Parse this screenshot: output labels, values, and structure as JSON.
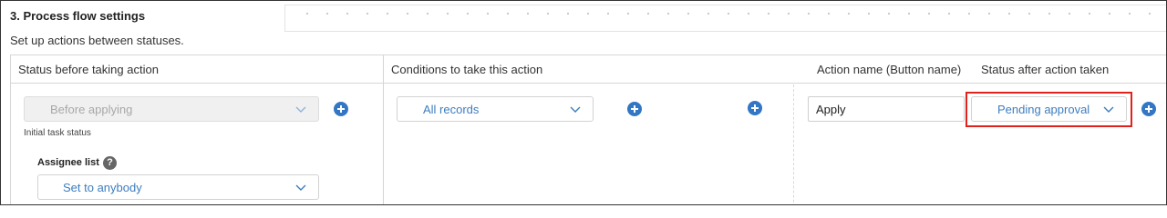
{
  "section": {
    "title": "3. Process flow settings",
    "description": "Set up actions between statuses."
  },
  "table": {
    "headers": {
      "status_before": "Status before taking action",
      "conditions": "Conditions to take this action",
      "action_name": "Action name (Button name)",
      "status_after": "Status after action taken"
    }
  },
  "row": {
    "status_before": {
      "value": "Before applying",
      "disabled": true,
      "note": "Initial task status"
    },
    "assignee": {
      "label": "Assignee list",
      "help_icon": "?",
      "value": "Set to anybody"
    },
    "condition": {
      "value": "All records"
    },
    "action_name": {
      "value": "Apply"
    },
    "status_after": {
      "value": "Pending approval",
      "highlighted": true
    }
  },
  "icons": {
    "add": "plus-circle-icon",
    "dropdown": "chevron-down-icon",
    "help": "question-circle-icon"
  },
  "colors": {
    "accent": "#3276c4",
    "link_text": "#3d7dbf",
    "highlight": "#e0211c"
  }
}
